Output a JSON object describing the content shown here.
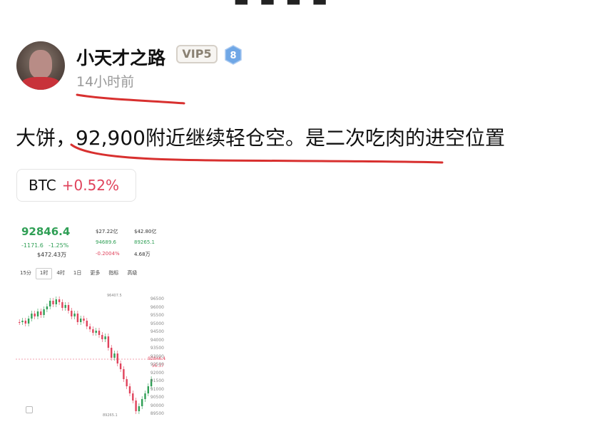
{
  "post": {
    "username": "小天才之路",
    "vip_label": "VIP5",
    "level": "8",
    "timestamp": "14小时前",
    "text": "大饼，92,900附近继续轻仓空。是二次吃肉的进空位置"
  },
  "ticker_chip": {
    "symbol": "BTC",
    "change": "+0.52%"
  },
  "chart_card": {
    "price": "92846.4",
    "change_abs": "-1171.6",
    "change_pct": "-1.25%",
    "volume_value": "$472.43万",
    "stats": {
      "amount": "$27.22亿",
      "market_cap": "$42.80亿",
      "high": "94689.6",
      "low": "89265.1",
      "rate": "-0.2004%",
      "open_interest": "4.68万"
    },
    "tabs": [
      "15分",
      "1时",
      "4时",
      "1日",
      "更多",
      "指标",
      "高级"
    ],
    "active_tab": "1时",
    "y_ticks": [
      "96500",
      "96000",
      "95500",
      "95000",
      "94500",
      "94000",
      "93500",
      "93000",
      "92500",
      "92000",
      "91500",
      "91000",
      "90500",
      "90000",
      "89500"
    ],
    "current_price_tag": "92846.4",
    "countdown": "56:37",
    "high_marker": "96407.5",
    "low_marker": "89265.1"
  },
  "colors": {
    "up": "#2f9f55",
    "down": "#e0435c",
    "annotation": "#d8302f"
  }
}
